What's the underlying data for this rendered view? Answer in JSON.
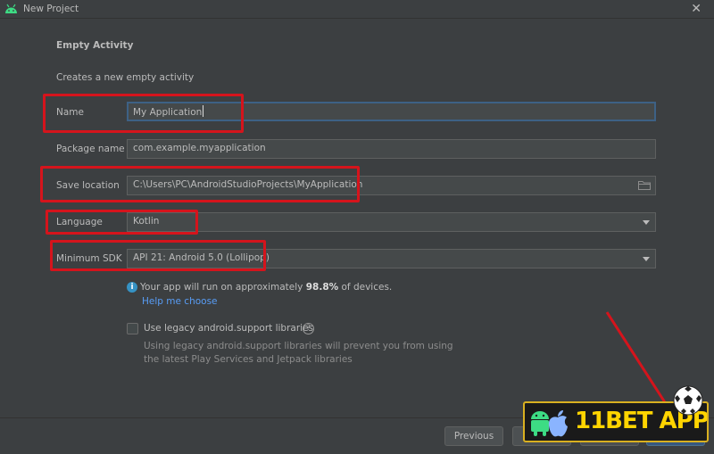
{
  "window": {
    "title": "New Project",
    "close_glyph": "✕"
  },
  "template": {
    "heading": "Empty Activity",
    "description": "Creates a new empty activity"
  },
  "form": {
    "name": {
      "label": "Name",
      "value": "My Application"
    },
    "package": {
      "label": "Package name",
      "value": "com.example.myapplication"
    },
    "save_location": {
      "label": "Save location",
      "value": "C:\\Users\\PC\\AndroidStudioProjects\\MyApplication",
      "icon": "folder-icon"
    },
    "language": {
      "label": "Language",
      "value": "Kotlin"
    },
    "min_sdk": {
      "label": "Minimum SDK",
      "value": "API 21: Android 5.0 (Lollipop)"
    }
  },
  "info": {
    "prefix": "Your app will run on approximately",
    "percent": "98.8%",
    "suffix": "of devices.",
    "help_link": "Help me choose"
  },
  "legacy": {
    "checkbox_label": "Use legacy android.support libraries",
    "checked": false,
    "hint_line1": "Using legacy android.support libraries will prevent you from using",
    "hint_line2": "the latest Play Services and Jetpack libraries"
  },
  "buttons": {
    "previous": "Previous"
  },
  "watermark": {
    "text": "11BET APP"
  },
  "colors": {
    "highlight": "#d5141c",
    "link": "#589df6",
    "focus": "#3d6185",
    "logo_gold": "#ffd400"
  }
}
